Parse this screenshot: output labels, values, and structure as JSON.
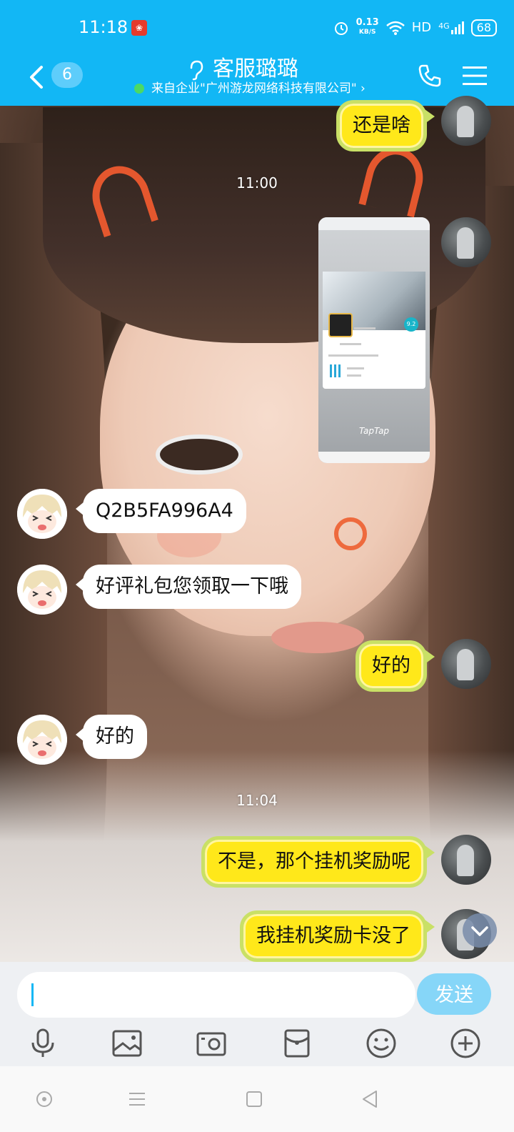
{
  "status_bar": {
    "time": "11:18",
    "notification_icon": "red-app-notification",
    "net_speed_value": "0.13",
    "net_speed_unit": "KB/S",
    "hd_label": "HD",
    "signal_label": "4G",
    "battery": "68"
  },
  "header": {
    "unread_count": "6",
    "title": "客服璐璐",
    "subtitle": "来自企业\"广州游龙网络科技有限公司\" ›",
    "accent_color": "#12b7f5"
  },
  "messages": [
    {
      "side": "me",
      "type": "text",
      "text": "还是啥"
    },
    {
      "type": "time",
      "text": "11:00"
    },
    {
      "side": "me",
      "type": "image",
      "caption": "TapTap",
      "rating": "9.2"
    },
    {
      "side": "cs",
      "type": "text",
      "text": "Q2B5FA996A4"
    },
    {
      "side": "cs",
      "type": "text",
      "text": "好评礼包您领取一下哦"
    },
    {
      "side": "me",
      "type": "text",
      "text": "好的"
    },
    {
      "side": "cs",
      "type": "text",
      "text": "好的"
    },
    {
      "type": "time",
      "text": "11:04"
    },
    {
      "side": "me",
      "type": "text",
      "text": "不是，那个挂机奖励呢"
    },
    {
      "side": "me",
      "type": "text",
      "text": "我挂机奖励卡没了"
    }
  ],
  "input": {
    "value": "",
    "send_label": "发送"
  },
  "toolbar_icons": [
    "microphone-icon",
    "image-icon",
    "camera-icon",
    "red-packet-icon",
    "emoji-icon",
    "plus-icon"
  ],
  "navigation_icons": [
    "assistant-icon",
    "menu-icon",
    "home-icon",
    "back-icon"
  ]
}
